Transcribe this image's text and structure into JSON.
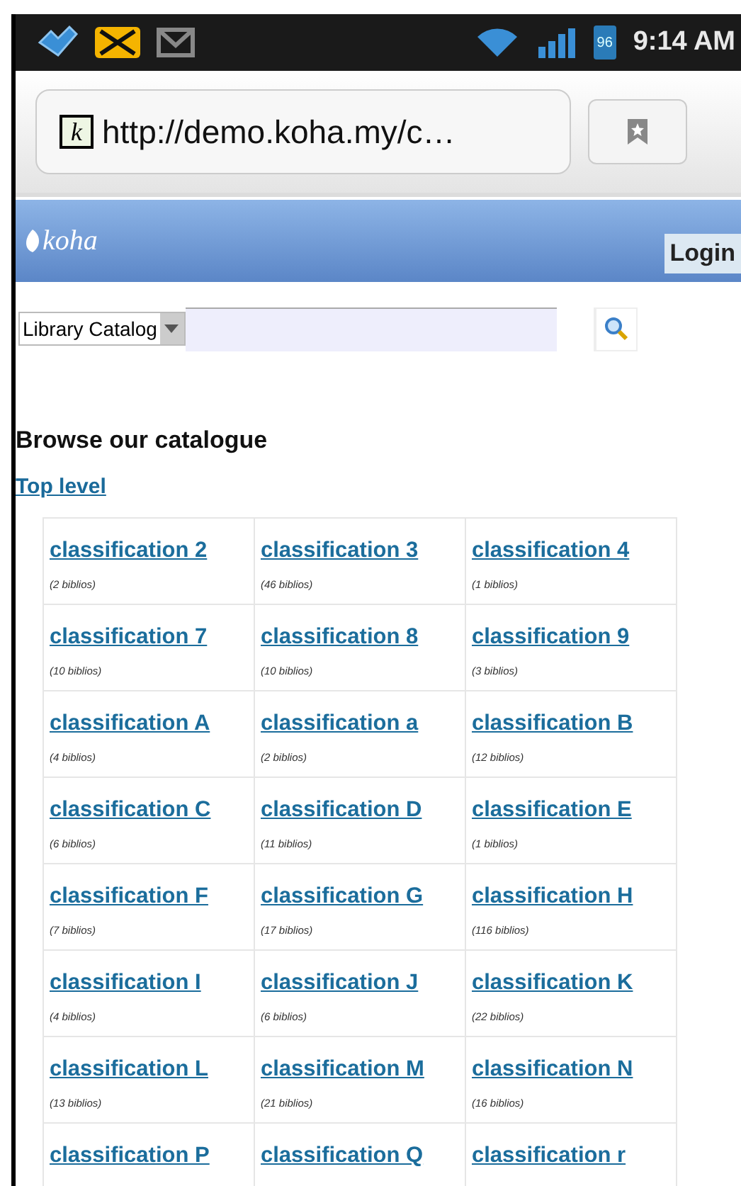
{
  "status_bar": {
    "battery": "96",
    "time": "9:14 AM"
  },
  "browser": {
    "favicon": "k",
    "url": "http://demo.koha.my/c…"
  },
  "header": {
    "logo": "koha",
    "login": "Login"
  },
  "search": {
    "scope": "Library Catalog"
  },
  "heading": "Browse our catalogue",
  "breadcrumb": "Top level",
  "rows": [
    [
      {
        "label": "classification 2",
        "count": "(2 biblios)"
      },
      {
        "label": "classification 3",
        "count": "(46 biblios)"
      },
      {
        "label": "classification 4",
        "count": "(1 biblios)"
      }
    ],
    [
      {
        "label": "classification 7",
        "count": "(10 biblios)"
      },
      {
        "label": "classification 8",
        "count": "(10 biblios)"
      },
      {
        "label": "classification 9",
        "count": "(3 biblios)"
      }
    ],
    [
      {
        "label": "classification A",
        "count": "(4 biblios)"
      },
      {
        "label": "classification a",
        "count": "(2 biblios)"
      },
      {
        "label": "classification B",
        "count": "(12 biblios)"
      }
    ],
    [
      {
        "label": "classification C",
        "count": "(6 biblios)"
      },
      {
        "label": "classification D",
        "count": "(11 biblios)"
      },
      {
        "label": "classification E",
        "count": "(1 biblios)"
      }
    ],
    [
      {
        "label": "classification F",
        "count": "(7 biblios)"
      },
      {
        "label": "classification G",
        "count": "(17 biblios)"
      },
      {
        "label": "classification H",
        "count": "(116 biblios)"
      }
    ],
    [
      {
        "label": "classification I",
        "count": "(4 biblios)"
      },
      {
        "label": "classification J",
        "count": "(6 biblios)"
      },
      {
        "label": "classification K",
        "count": "(22 biblios)"
      }
    ],
    [
      {
        "label": "classification L",
        "count": "(13 biblios)"
      },
      {
        "label": "classification M",
        "count": "(21 biblios)"
      },
      {
        "label": "classification N",
        "count": "(16 biblios)"
      }
    ],
    [
      {
        "label": "classification P"
      },
      {
        "label": "classification Q"
      },
      {
        "label": "classification r"
      }
    ]
  ]
}
